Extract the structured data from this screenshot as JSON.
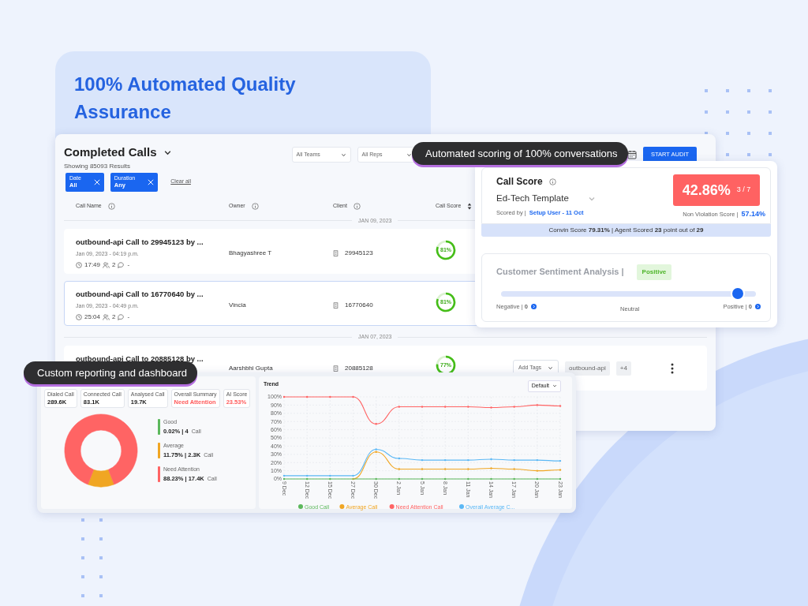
{
  "hero": {
    "title": "100% Automated Quality Assurance"
  },
  "calls": {
    "title": "Completed Calls",
    "subtitle": "Showing 85093 Results",
    "selects": [
      "All Teams",
      "All Reps"
    ],
    "action": "START AUDIT",
    "chips": [
      {
        "label": "Date",
        "value": "All"
      },
      {
        "label": "Duration",
        "value": "Any"
      }
    ],
    "clear": "Clear all",
    "columns": [
      {
        "label": "Call Name",
        "kind": "info"
      },
      {
        "label": "Owner",
        "kind": "info"
      },
      {
        "label": "Client",
        "kind": "info"
      },
      {
        "label": "Call Score",
        "kind": "sort"
      }
    ],
    "groups": [
      {
        "date": "JAN 09, 2023",
        "rows": [
          {
            "name": "outbound-api Call to 29945123 by ...",
            "when": "Jan 09, 2023 - 04:19 p.m.",
            "duration": "17:49",
            "participants": "2",
            "comments": "-",
            "owner": "Bhagyashree T",
            "client": "29945123",
            "score": "81%",
            "level": 0.81,
            "selected": false
          },
          {
            "name": "outbound-api Call to 16770640 by ...",
            "when": "Jan 09, 2023 - 04:49 p.m.",
            "duration": "25:04",
            "participants": "2",
            "comments": "-",
            "owner": "Vincia",
            "client": "16770640",
            "score": "81%",
            "level": 0.81,
            "selected": true
          }
        ]
      },
      {
        "date": "JAN 07, 2023",
        "rows": [
          {
            "name": "outbound-api Call to 20885128 by ...",
            "owner": "Aarshbhi Gupta",
            "client": "20885128",
            "score": "77%",
            "level": 0.77,
            "selected": false,
            "tag_select": "Add Tags",
            "tags": [
              "outbound-api"
            ],
            "more": "+4"
          }
        ]
      }
    ]
  },
  "tooltips": [
    {
      "text": "Automated scoring of 100% conversations"
    },
    {
      "text": "Custom reporting and dashboard"
    }
  ],
  "score_card": {
    "title": "Call Score",
    "template": "Ed-Tech Template",
    "scored_by_label": "Scored by |",
    "scored_by": "Setup User - 11 Oct",
    "score": "42.86%",
    "fraction": "3 / 7",
    "non_violation_label": "Non Violation Score |",
    "non_violation": "57.14%",
    "summary": "Convin Score **79.31%** | Agent Scored **23** point out of **29**",
    "sentiment": {
      "title": "Customer Sentiment Analysis |",
      "badge": "Positive",
      "level": 0.93,
      "negative": "Negative | **0**",
      "neutral": "Neutral",
      "positive": "Positive | **0**"
    }
  },
  "dashboard": {
    "stats": [
      {
        "label": "Dialed Call",
        "value": "289.6K",
        "alert": false
      },
      {
        "label": "Connected Call",
        "value": "83.1K",
        "alert": false
      },
      {
        "label": "Analysed Call",
        "value": "19.7K",
        "alert": false
      },
      {
        "label": "Overall Summary",
        "value": "Need Attention",
        "alert": true
      },
      {
        "label": "AI Score",
        "value": "23.53%",
        "alert": true
      }
    ],
    "distribution": {
      "chart_data": {
        "type": "donut",
        "categories": [
          "Good",
          "Average",
          "Need Attention"
        ],
        "values": [
          null,
          11.75,
          88.23
        ]
      },
      "legend": [
        {
          "value": "0.02% | 4",
          "unit": "Call",
          "color": "#5cb85c"
        },
        {
          "value": "11.75% | 2.3K",
          "unit": "Call",
          "color": "#f0a623"
        },
        {
          "value": "88.23% | 17.4K",
          "unit": "Call",
          "color": "#ff6464"
        }
      ]
    },
    "trend": {
      "title": "Trend",
      "view": "Default",
      "chart_data": {
        "type": "line",
        "grid": true,
        "legend": "bottom",
        "categories": [
          "9 Dec",
          "12 Dec",
          "15 Dec",
          "27 Dec",
          "30 Dec",
          "2 Jan",
          "5 Jan",
          "8 Jan",
          "11 Jan",
          "14 Jan",
          "17 Jan",
          "20 Jan",
          "23 Jan"
        ],
        "ylim": [
          0,
          100
        ],
        "yticks": [
          {
            "value": 0,
            "label": "0%"
          },
          {
            "value": 10,
            "label": "10%"
          },
          {
            "value": 20,
            "label": "20%"
          },
          {
            "value": 30,
            "label": "30%"
          },
          {
            "value": 40,
            "label": "40%"
          },
          {
            "value": 50,
            "label": "50%"
          },
          {
            "value": 60,
            "label": "60%"
          },
          {
            "value": 70,
            "label": "70%"
          },
          {
            "value": 80,
            "label": "80%"
          },
          {
            "value": 90,
            "label": "90%"
          },
          {
            "value": 100,
            "label": "100%"
          }
        ],
        "series": [
          {
            "name": "Good Call",
            "color": "#5cb85c",
            "values": [
              0,
              0,
              0,
              0,
              0,
              0,
              0,
              0,
              0,
              0,
              0,
              0,
              0
            ]
          },
          {
            "name": "Average Call",
            "color": "#f0a623",
            "values": [
              null,
              null,
              null,
              0,
              33,
              12,
              12,
              12,
              12,
              13,
              12,
              10,
              11
            ]
          },
          {
            "name": "Need Attention Call",
            "color": "#ff6464",
            "values": [
              100,
              100,
              100,
              100,
              67,
              88,
              88,
              88,
              88,
              87,
              88,
              90,
              89
            ]
          },
          {
            "name": "Overall Average C...",
            "color": "#5bb8f5",
            "values": [
              4,
              4,
              4,
              4,
              36,
              25,
              23,
              23,
              23,
              24,
              23,
              23,
              22
            ]
          }
        ]
      }
    }
  }
}
